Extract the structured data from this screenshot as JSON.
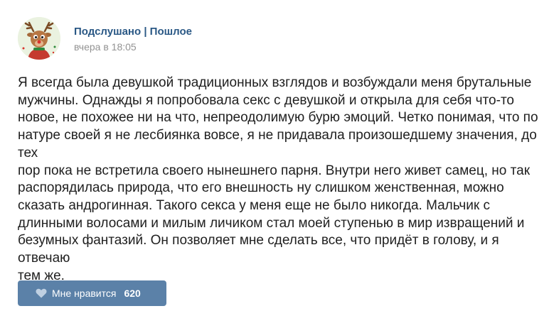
{
  "post": {
    "author": "Подслушано | Пошлое",
    "time": "вчера в 18:05",
    "avatar_icon": "reindeer-avatar",
    "text_lines": [
      "Я всегда была девушкой традиционных взглядов и возбуждали меня брутальные",
      "мужчины. Однажды я попробовала секс с девушкой и открыла для себя что-то",
      "новое, не похожее ни на что, непреодолимую бурю эмоций. Четко понимая, что по",
      "натуре своей я не лесбиянка вовсе, я не придавала произошедшему значения, до тех",
      "пор пока не встретила своего нынешнего парня. Внутри него живет самец, но так",
      "распорядилась природа, что его внешность ну слишком женственная, можно",
      "сказать андрогинная. Такого секса у меня еще не было никогда. Мальчик с",
      "длинными волосами и милым личиком стал моей ступенью в мир извращений и",
      "безумных фантазий. Он позволяет мне сделать все, что придёт в голову, и я отвечаю",
      "тем же."
    ]
  },
  "like": {
    "label": "Мне нравится",
    "count": "620",
    "icon": "heart-icon"
  },
  "colors": {
    "author": "#2a5885",
    "time": "#939393",
    "text": "#1f1f1f",
    "like_button": "#5b81a8"
  }
}
